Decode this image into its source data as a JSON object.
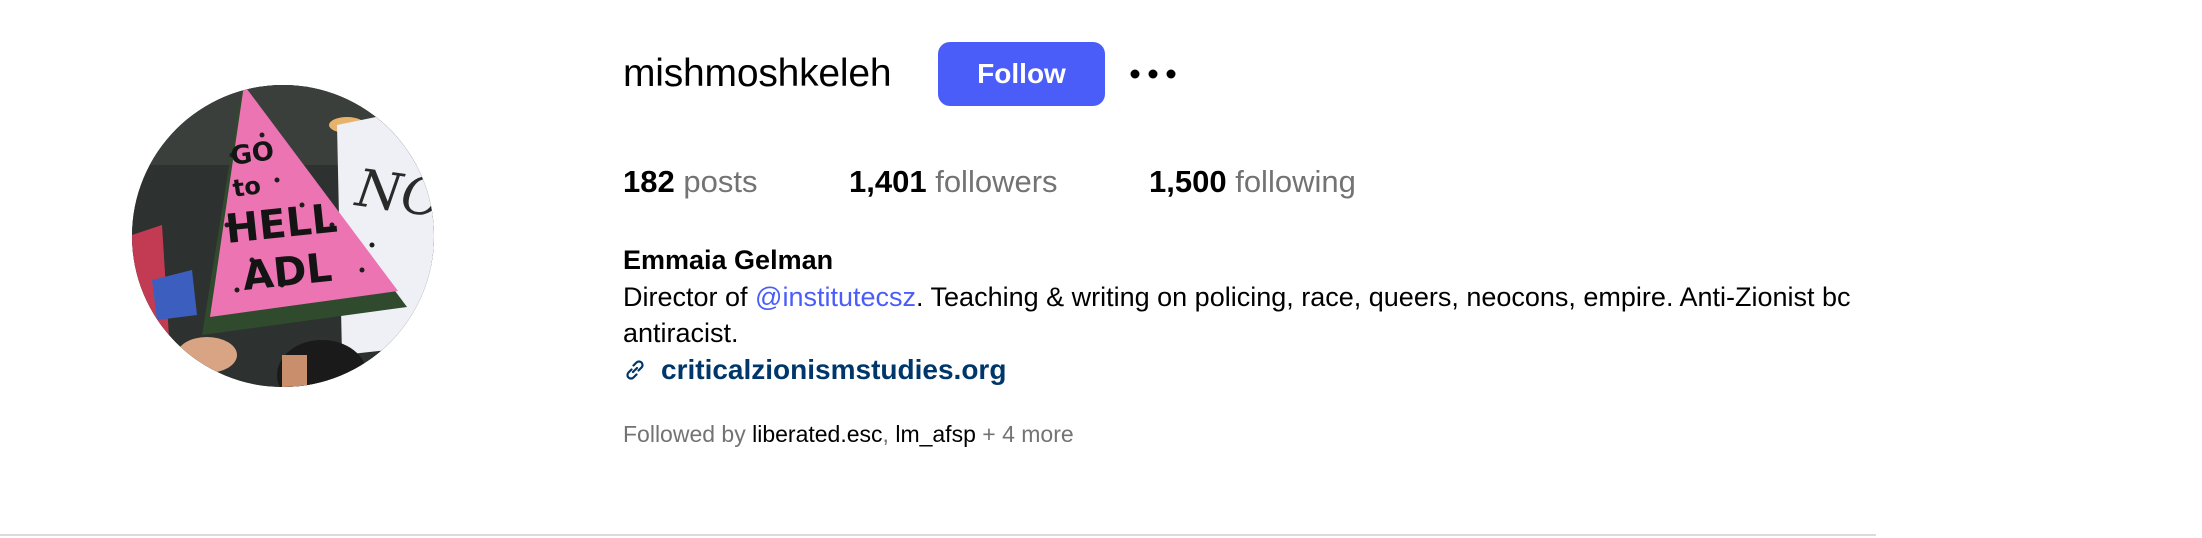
{
  "profile": {
    "username": "mishmoshkeleh",
    "follow_label": "Follow",
    "more_icon": "more-horizontal-icon"
  },
  "stats": {
    "posts_count": "182",
    "posts_label": "posts",
    "followers_count": "1,401",
    "followers_label": "followers",
    "following_count": "1,500",
    "following_label": "following"
  },
  "bio": {
    "full_name": "Emmaia Gelman",
    "text_before": "Director of ",
    "mention": "@institutecsz",
    "text_after": ". Teaching & writing on policing, race, queers, neocons, empire. Anti-Zionist bc antiracist.",
    "link_icon": "link-icon",
    "link": "criticalzionismstudies.org"
  },
  "followed_by": {
    "prefix": "Followed by ",
    "user1": "liberated.esc",
    "separator": ", ",
    "user2": "lm_afsp",
    "suffix": " + 4 more"
  },
  "avatar": {
    "sign_text_line1": "GO",
    "sign_text_line2": "to",
    "sign_text_line3": "HELL",
    "sign_text_line4": "ADL",
    "background_sign": "NO"
  },
  "colors": {
    "accent": "#4a5df9",
    "link": "#00376b",
    "muted": "#737373",
    "sign_pink": "#ec74b2",
    "sign_green": "#2f4a2c"
  }
}
